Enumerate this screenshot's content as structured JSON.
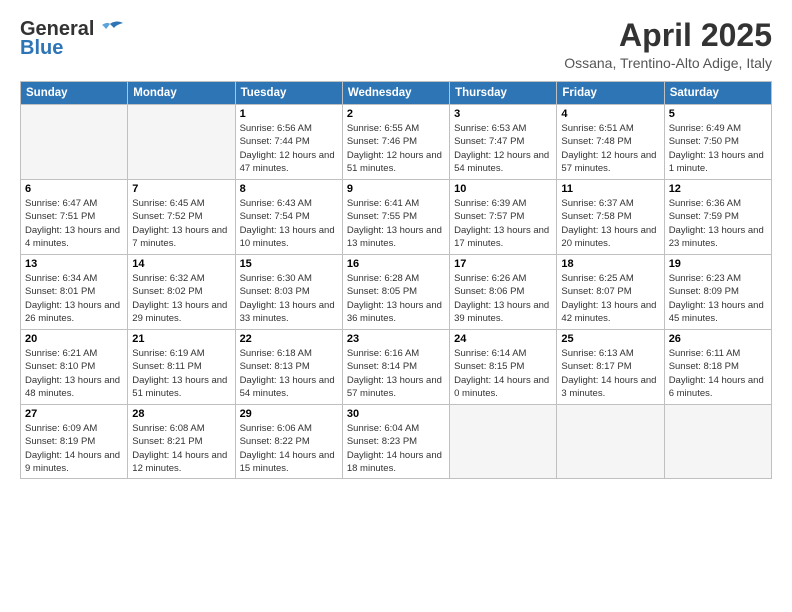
{
  "header": {
    "logo_general": "General",
    "logo_blue": "Blue",
    "month_title": "April 2025",
    "location": "Ossana, Trentino-Alto Adige, Italy"
  },
  "days_of_week": [
    "Sunday",
    "Monday",
    "Tuesday",
    "Wednesday",
    "Thursday",
    "Friday",
    "Saturday"
  ],
  "weeks": [
    [
      {
        "day": "",
        "sunrise": "",
        "sunset": "",
        "daylight": "",
        "empty": true
      },
      {
        "day": "",
        "sunrise": "",
        "sunset": "",
        "daylight": "",
        "empty": true
      },
      {
        "day": "1",
        "sunrise": "Sunrise: 6:56 AM",
        "sunset": "Sunset: 7:44 PM",
        "daylight": "Daylight: 12 hours and 47 minutes."
      },
      {
        "day": "2",
        "sunrise": "Sunrise: 6:55 AM",
        "sunset": "Sunset: 7:46 PM",
        "daylight": "Daylight: 12 hours and 51 minutes."
      },
      {
        "day": "3",
        "sunrise": "Sunrise: 6:53 AM",
        "sunset": "Sunset: 7:47 PM",
        "daylight": "Daylight: 12 hours and 54 minutes."
      },
      {
        "day": "4",
        "sunrise": "Sunrise: 6:51 AM",
        "sunset": "Sunset: 7:48 PM",
        "daylight": "Daylight: 12 hours and 57 minutes."
      },
      {
        "day": "5",
        "sunrise": "Sunrise: 6:49 AM",
        "sunset": "Sunset: 7:50 PM",
        "daylight": "Daylight: 13 hours and 1 minute."
      }
    ],
    [
      {
        "day": "6",
        "sunrise": "Sunrise: 6:47 AM",
        "sunset": "Sunset: 7:51 PM",
        "daylight": "Daylight: 13 hours and 4 minutes."
      },
      {
        "day": "7",
        "sunrise": "Sunrise: 6:45 AM",
        "sunset": "Sunset: 7:52 PM",
        "daylight": "Daylight: 13 hours and 7 minutes."
      },
      {
        "day": "8",
        "sunrise": "Sunrise: 6:43 AM",
        "sunset": "Sunset: 7:54 PM",
        "daylight": "Daylight: 13 hours and 10 minutes."
      },
      {
        "day": "9",
        "sunrise": "Sunrise: 6:41 AM",
        "sunset": "Sunset: 7:55 PM",
        "daylight": "Daylight: 13 hours and 13 minutes."
      },
      {
        "day": "10",
        "sunrise": "Sunrise: 6:39 AM",
        "sunset": "Sunset: 7:57 PM",
        "daylight": "Daylight: 13 hours and 17 minutes."
      },
      {
        "day": "11",
        "sunrise": "Sunrise: 6:37 AM",
        "sunset": "Sunset: 7:58 PM",
        "daylight": "Daylight: 13 hours and 20 minutes."
      },
      {
        "day": "12",
        "sunrise": "Sunrise: 6:36 AM",
        "sunset": "Sunset: 7:59 PM",
        "daylight": "Daylight: 13 hours and 23 minutes."
      }
    ],
    [
      {
        "day": "13",
        "sunrise": "Sunrise: 6:34 AM",
        "sunset": "Sunset: 8:01 PM",
        "daylight": "Daylight: 13 hours and 26 minutes."
      },
      {
        "day": "14",
        "sunrise": "Sunrise: 6:32 AM",
        "sunset": "Sunset: 8:02 PM",
        "daylight": "Daylight: 13 hours and 29 minutes."
      },
      {
        "day": "15",
        "sunrise": "Sunrise: 6:30 AM",
        "sunset": "Sunset: 8:03 PM",
        "daylight": "Daylight: 13 hours and 33 minutes."
      },
      {
        "day": "16",
        "sunrise": "Sunrise: 6:28 AM",
        "sunset": "Sunset: 8:05 PM",
        "daylight": "Daylight: 13 hours and 36 minutes."
      },
      {
        "day": "17",
        "sunrise": "Sunrise: 6:26 AM",
        "sunset": "Sunset: 8:06 PM",
        "daylight": "Daylight: 13 hours and 39 minutes."
      },
      {
        "day": "18",
        "sunrise": "Sunrise: 6:25 AM",
        "sunset": "Sunset: 8:07 PM",
        "daylight": "Daylight: 13 hours and 42 minutes."
      },
      {
        "day": "19",
        "sunrise": "Sunrise: 6:23 AM",
        "sunset": "Sunset: 8:09 PM",
        "daylight": "Daylight: 13 hours and 45 minutes."
      }
    ],
    [
      {
        "day": "20",
        "sunrise": "Sunrise: 6:21 AM",
        "sunset": "Sunset: 8:10 PM",
        "daylight": "Daylight: 13 hours and 48 minutes."
      },
      {
        "day": "21",
        "sunrise": "Sunrise: 6:19 AM",
        "sunset": "Sunset: 8:11 PM",
        "daylight": "Daylight: 13 hours and 51 minutes."
      },
      {
        "day": "22",
        "sunrise": "Sunrise: 6:18 AM",
        "sunset": "Sunset: 8:13 PM",
        "daylight": "Daylight: 13 hours and 54 minutes."
      },
      {
        "day": "23",
        "sunrise": "Sunrise: 6:16 AM",
        "sunset": "Sunset: 8:14 PM",
        "daylight": "Daylight: 13 hours and 57 minutes."
      },
      {
        "day": "24",
        "sunrise": "Sunrise: 6:14 AM",
        "sunset": "Sunset: 8:15 PM",
        "daylight": "Daylight: 14 hours and 0 minutes."
      },
      {
        "day": "25",
        "sunrise": "Sunrise: 6:13 AM",
        "sunset": "Sunset: 8:17 PM",
        "daylight": "Daylight: 14 hours and 3 minutes."
      },
      {
        "day": "26",
        "sunrise": "Sunrise: 6:11 AM",
        "sunset": "Sunset: 8:18 PM",
        "daylight": "Daylight: 14 hours and 6 minutes."
      }
    ],
    [
      {
        "day": "27",
        "sunrise": "Sunrise: 6:09 AM",
        "sunset": "Sunset: 8:19 PM",
        "daylight": "Daylight: 14 hours and 9 minutes."
      },
      {
        "day": "28",
        "sunrise": "Sunrise: 6:08 AM",
        "sunset": "Sunset: 8:21 PM",
        "daylight": "Daylight: 14 hours and 12 minutes."
      },
      {
        "day": "29",
        "sunrise": "Sunrise: 6:06 AM",
        "sunset": "Sunset: 8:22 PM",
        "daylight": "Daylight: 14 hours and 15 minutes."
      },
      {
        "day": "30",
        "sunrise": "Sunrise: 6:04 AM",
        "sunset": "Sunset: 8:23 PM",
        "daylight": "Daylight: 14 hours and 18 minutes."
      },
      {
        "day": "",
        "sunrise": "",
        "sunset": "",
        "daylight": "",
        "empty": true
      },
      {
        "day": "",
        "sunrise": "",
        "sunset": "",
        "daylight": "",
        "empty": true
      },
      {
        "day": "",
        "sunrise": "",
        "sunset": "",
        "daylight": "",
        "empty": true
      }
    ]
  ]
}
